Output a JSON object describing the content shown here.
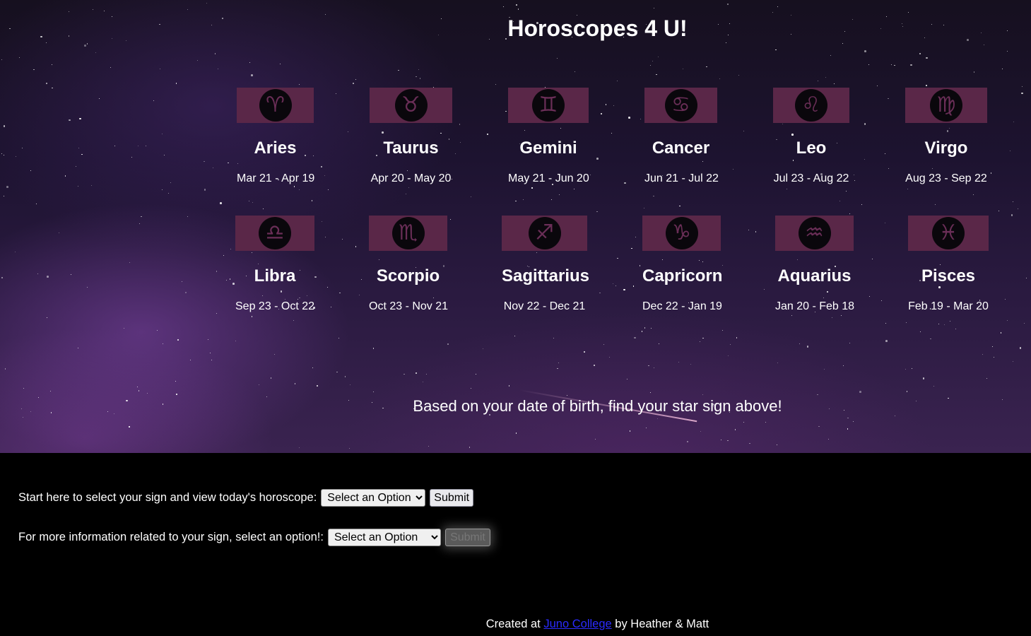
{
  "header": {
    "title": "Horoscopes 4 U!"
  },
  "signs": [
    {
      "name": "Aries",
      "dates": "Mar 21 - Apr 19",
      "glyph": "♈",
      "icon": "aries-icon"
    },
    {
      "name": "Taurus",
      "dates": "Apr 20 - May 20",
      "glyph": "♉",
      "icon": "taurus-icon"
    },
    {
      "name": "Gemini",
      "dates": "May 21 - Jun 20",
      "glyph": "♊",
      "icon": "gemini-icon"
    },
    {
      "name": "Cancer",
      "dates": "Jun 21 - Jul 22",
      "glyph": "♋",
      "icon": "cancer-icon"
    },
    {
      "name": "Leo",
      "dates": "Jul 23 - Aug 22",
      "glyph": "♌",
      "icon": "leo-icon"
    },
    {
      "name": "Virgo",
      "dates": "Aug 23 - Sep 22",
      "glyph": "♍",
      "icon": "virgo-icon"
    },
    {
      "name": "Libra",
      "dates": "Sep 23 - Oct 22",
      "glyph": "♎",
      "icon": "libra-icon"
    },
    {
      "name": "Scorpio",
      "dates": "Oct 23 - Nov 21",
      "glyph": "♏",
      "icon": "scorpio-icon"
    },
    {
      "name": "Sagittarius",
      "dates": "Nov 22 - Dec 21",
      "glyph": "♐",
      "icon": "sagittarius-icon"
    },
    {
      "name": "Capricorn",
      "dates": "Dec 22 - Jan 19",
      "glyph": "♑",
      "icon": "capricorn-icon"
    },
    {
      "name": "Aquarius",
      "dates": "Jan 20 - Feb 18",
      "glyph": "♒",
      "icon": "aquarius-icon"
    },
    {
      "name": "Pisces",
      "dates": "Feb 19 - Mar 20",
      "glyph": "♓",
      "icon": "pisces-icon"
    }
  ],
  "hero": {
    "tagline": "Based on your date of birth, find your star sign above!"
  },
  "form": {
    "horoscope_label": "Start here to select your sign and view today's horoscope:",
    "horoscope_select": "Select an Option",
    "horoscope_submit": "Submit",
    "info_label": "For more information related to your sign, select an option!:",
    "info_select": "Select an Option",
    "info_submit": "Submit"
  },
  "footer": {
    "prefix": "Created at",
    "link": "Juno College",
    "suffix": "by Heather & Matt"
  },
  "colors": {
    "band": "#5a2748",
    "glyph": "#6a2e57",
    "link": "#2b2bff"
  }
}
